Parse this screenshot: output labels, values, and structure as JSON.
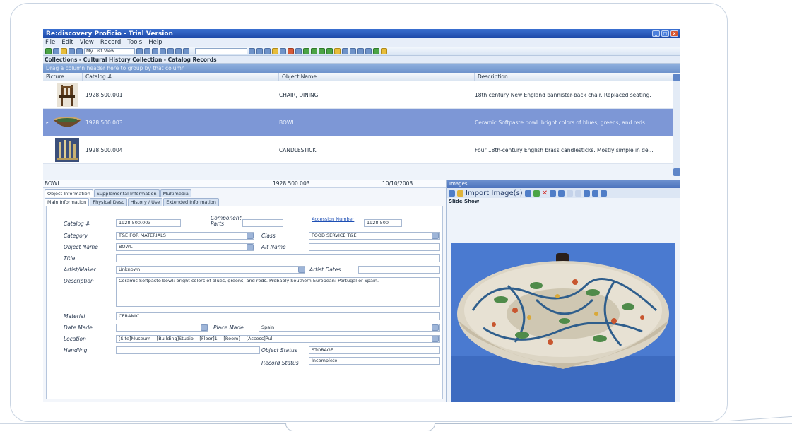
{
  "window": {
    "title": "Re:discovery Proficio - Trial Version"
  },
  "menu": [
    "File",
    "Edit",
    "View",
    "Record",
    "Tools",
    "Help"
  ],
  "toolbar": {
    "view_select": "My List View"
  },
  "breadcrumb": "Collections - Cultural History Collection - Catalog Records",
  "grid": {
    "group_hint": "Drag a column header here to group by that column",
    "columns": [
      "Picture",
      "Catalog #",
      "Object Name",
      "Description"
    ],
    "rows": [
      {
        "catalog": "1928.500.001",
        "object_name": "CHAIR, DINING",
        "description": "18th century New England bannister-back chair.  Replaced seating."
      },
      {
        "catalog": "1928.500.003",
        "object_name": "BOWL",
        "description": "Ceramic Softpaste bowl: bright colors of blues, greens, and reds..."
      },
      {
        "catalog": "1928.500.004",
        "object_name": "CANDLESTICK",
        "description": "Four 18th-century English brass candlesticks. Mostly simple in de..."
      }
    ]
  },
  "record": {
    "header_name": "BOWL",
    "header_number": "1928.500.003",
    "header_date": "10/10/2003",
    "tabs": [
      "Object Information",
      "Supplemental Information",
      "Multimedia"
    ],
    "subtabs": [
      "Main Information",
      "Physical Desc",
      "History / Use",
      "Extended Information"
    ],
    "labels": {
      "catalog": "Catalog #",
      "component_parts": "Component Parts",
      "accession_number": "Accession Number",
      "category": "Category",
      "class": "Class",
      "object_name": "Object Name",
      "alt_name": "Alt Name",
      "title": "Title",
      "artist_maker": "Artist/Maker",
      "artist_dates": "Artist Dates",
      "description": "Description",
      "material": "Material",
      "date_made": "Date Made",
      "place_made": "Place Made",
      "location": "Location",
      "handling": "Handling",
      "object_status": "Object Status",
      "record_status": "Record Status"
    },
    "values": {
      "catalog": "1928.500.003",
      "component_parts": "-",
      "accession_number": "1928.500",
      "category": "T&E FOR MATERIALS",
      "class": "FOOD SERVICE T&E",
      "object_name": "BOWL",
      "alt_name": "",
      "title": "",
      "artist_maker": "Unknown",
      "artist_dates": "",
      "description": "Ceramic Softpaste bowl: bright colors of blues, greens, and reds.  Probably Southern European: Portugal or Spain.",
      "material": "CERAMIC",
      "date_made": "",
      "place_made": "Spain",
      "location": "[Site]Museum __[Building]Studio __[Floor]1 __[Room] __[Access]Pull",
      "handling": "",
      "object_status": "STORAGE",
      "record_status": "Incomplete"
    }
  },
  "images_panel": {
    "title": "Images",
    "import_label": "Import Image(s)",
    "slide_show": "Slide Show"
  }
}
